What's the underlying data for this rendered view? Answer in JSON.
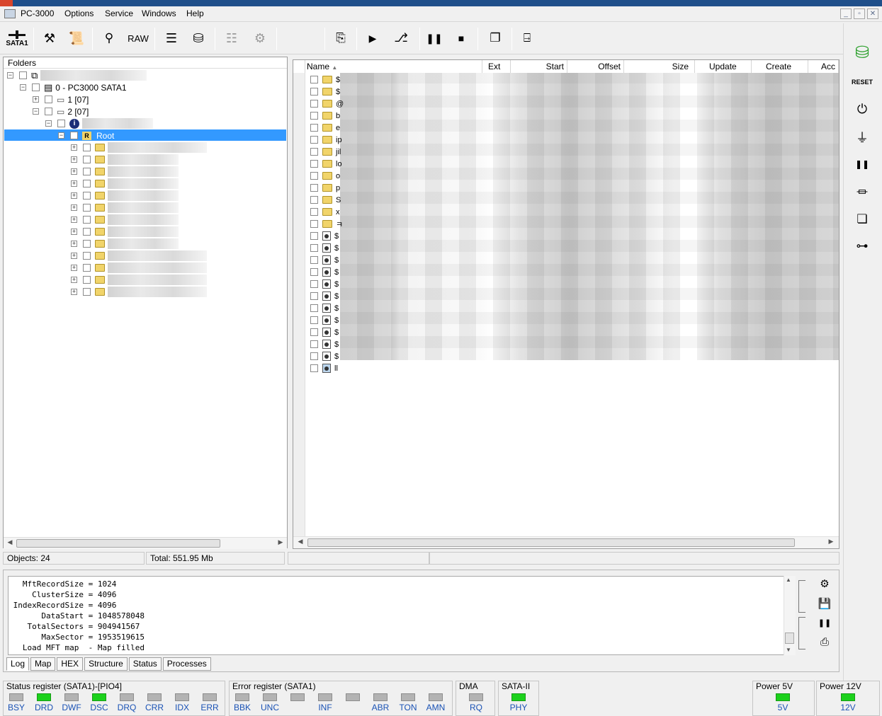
{
  "app": {
    "title": "PC-3000"
  },
  "menu": [
    "Options",
    "Service",
    "Windows",
    "Help"
  ],
  "toolbar": {
    "sata_label": "SATA1",
    "raw_label": "RAW"
  },
  "tree": {
    "header": "Folders",
    "device": "0 - PC3000 SATA1",
    "partitions": [
      "1 [07]",
      "2 [07]"
    ],
    "root_label": "Root",
    "root_badge": "R"
  },
  "filelist": {
    "columns": [
      "Name",
      "Ext",
      "Start",
      "Offset",
      "Size",
      "Update",
      "Create",
      "Acc"
    ],
    "rows": [
      {
        "prefix": "$",
        "icon": "folder-icon"
      },
      {
        "prefix": "$",
        "icon": "folder-icon"
      },
      {
        "prefix": "@",
        "icon": "folder-icon"
      },
      {
        "prefix": "b",
        "icon": "folder-icon"
      },
      {
        "prefix": "e",
        "icon": "folder-icon"
      },
      {
        "prefix": "ip",
        "icon": "folder-icon"
      },
      {
        "prefix": "jil",
        "icon": "folder-icon"
      },
      {
        "prefix": "lo",
        "icon": "folder-icon"
      },
      {
        "prefix": "o",
        "icon": "folder-icon"
      },
      {
        "prefix": "p",
        "icon": "folder-icon"
      },
      {
        "prefix": "S",
        "icon": "folder-icon"
      },
      {
        "prefix": "x",
        "icon": "folder-icon"
      },
      {
        "prefix": "ㅋ",
        "icon": "folder-icon"
      },
      {
        "prefix": "$",
        "icon": "system-file-icon"
      },
      {
        "prefix": "$",
        "icon": "system-file-icon"
      },
      {
        "prefix": "$",
        "icon": "system-file-icon"
      },
      {
        "prefix": "$",
        "icon": "system-file-icon"
      },
      {
        "prefix": "$",
        "icon": "system-file-icon"
      },
      {
        "prefix": "$",
        "icon": "system-file-icon"
      },
      {
        "prefix": "$",
        "icon": "system-file-icon"
      },
      {
        "prefix": "$",
        "icon": "system-file-icon"
      },
      {
        "prefix": "$",
        "icon": "system-file-icon"
      },
      {
        "prefix": "$",
        "icon": "system-file-icon"
      },
      {
        "prefix": "$",
        "icon": "system-file-icon"
      },
      {
        "prefix": "ll",
        "icon": "image-file-icon"
      }
    ]
  },
  "status": {
    "objects": "Objects: 24",
    "total": "Total: 551.95 Mb"
  },
  "log": {
    "lines": [
      "   MftRecordSize = 1024",
      "     ClusterSize = 4096",
      " IndexRecordSize = 4096",
      "       DataStart = 1048578048",
      "    TotalSectors = 904941567",
      "       MaxSector = 1953519615",
      "   Load MFT map  - Map filled"
    ],
    "tabs": [
      "Log",
      "Map",
      "HEX",
      "Structure",
      "Status",
      "Processes"
    ]
  },
  "registers": {
    "status": {
      "title": "Status register (SATA1)-[PIO4]",
      "leds": [
        {
          "label": "BSY",
          "on": false
        },
        {
          "label": "DRD",
          "on": true
        },
        {
          "label": "DWF",
          "on": false
        },
        {
          "label": "DSC",
          "on": true
        },
        {
          "label": "DRQ",
          "on": false
        },
        {
          "label": "CRR",
          "on": false
        },
        {
          "label": "IDX",
          "on": false
        },
        {
          "label": "ERR",
          "on": false
        }
      ]
    },
    "error": {
      "title": "Error register (SATA1)",
      "leds": [
        {
          "label": "BBK",
          "on": false
        },
        {
          "label": "UNC",
          "on": false
        },
        {
          "label": "",
          "on": false
        },
        {
          "label": "INF",
          "on": false
        },
        {
          "label": "",
          "on": false
        },
        {
          "label": "ABR",
          "on": false
        },
        {
          "label": "TON",
          "on": false
        },
        {
          "label": "AMN",
          "on": false
        }
      ]
    },
    "dma": {
      "title": "DMA",
      "leds": [
        {
          "label": "RQ",
          "on": false
        }
      ]
    },
    "sata": {
      "title": "SATA-II",
      "leds": [
        {
          "label": "PHY",
          "on": true
        }
      ]
    },
    "power5": {
      "title": "Power 5V",
      "leds": [
        {
          "label": "5V",
          "on": true
        }
      ]
    },
    "power12": {
      "title": "Power 12V",
      "leds": [
        {
          "label": "12V",
          "on": true
        }
      ]
    }
  },
  "colors": {
    "selection": "#3399ff",
    "led_on": "#1cd11c",
    "led_off": "#b3b3b3",
    "reg_label": "#1a52b5"
  }
}
